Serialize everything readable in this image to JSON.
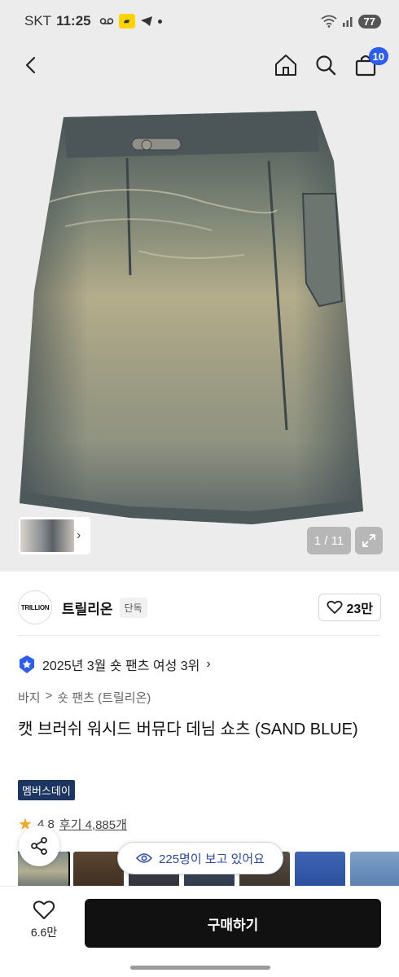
{
  "status_bar": {
    "carrier": "SKT",
    "time": "11:25",
    "battery": "77"
  },
  "nav": {
    "cart_count": "10"
  },
  "gallery": {
    "counter": "1 / 11"
  },
  "brand": {
    "logo_text": "TRILLION",
    "name": "트릴리온",
    "tag": "단독",
    "likes": "23만"
  },
  "ranking": {
    "text": "2025년 3월 숏 팬츠 여성 3위"
  },
  "breadcrumb": [
    "바지",
    ">",
    "숏 팬츠 (트릴리온)"
  ],
  "product": {
    "title": "캣 브러쉬 워시드 버뮤다 데님 쇼츠 (SAND BLUE)",
    "event_badge": "멤버스데이",
    "rating": "4.8",
    "reviews": "후기 4,885개"
  },
  "viewers": {
    "text": "225명이 보고 있어요"
  },
  "bottom": {
    "wish_count": "6.6만",
    "buy_label": "구매하기"
  },
  "colors": {
    "buy_button": "#111111",
    "badge_blue": "#2b5ef0",
    "event_badge": "#1d3561"
  }
}
